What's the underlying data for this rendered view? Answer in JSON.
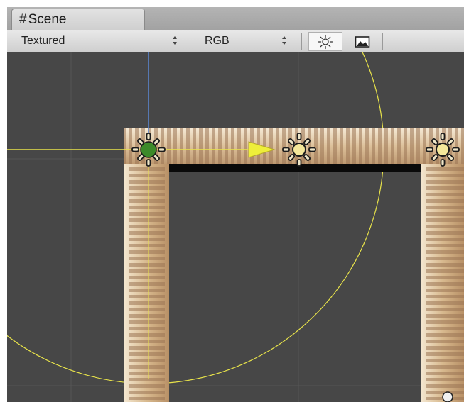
{
  "scene_tab": {
    "title": "Scene",
    "icon": "scene-grid-icon"
  },
  "toolbar": {
    "draw_mode": "Textured",
    "render_mode": "RGB",
    "lighting_toggle_icon": "sun-icon",
    "scene_view_toggle_icon": "image-icon"
  },
  "colors": {
    "viewport_bg": "#474747",
    "gizmo_yellow": "#e8e34a",
    "axis_blue": "#5b88d6",
    "selected_light": "#3d8a2a",
    "light_fill": "#f4e79a",
    "floor_tan": "#d9bc94"
  }
}
